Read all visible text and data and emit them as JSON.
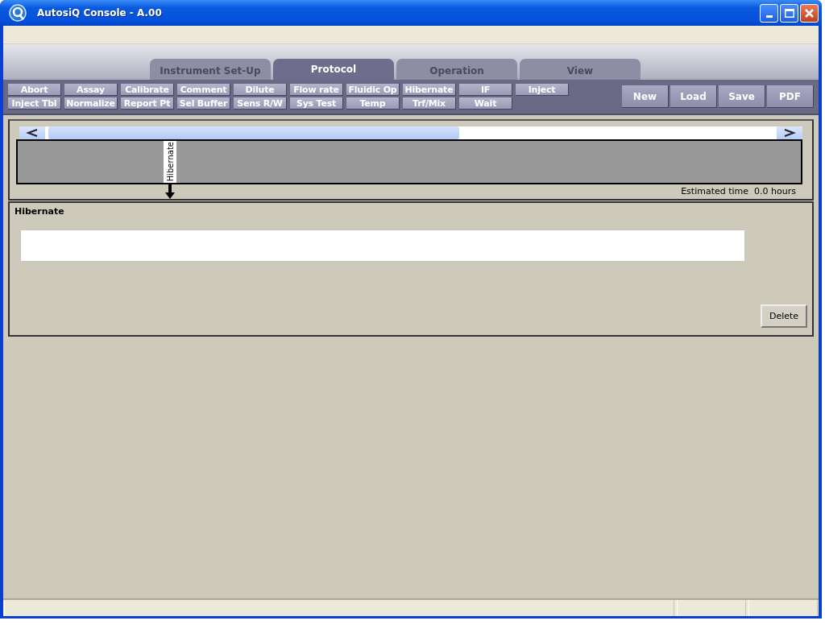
{
  "window": {
    "title": "AutosiQ Console - A.00"
  },
  "tabs": [
    {
      "label": "Instrument Set-Up",
      "selected": false
    },
    {
      "label": "Protocol",
      "selected": true
    },
    {
      "label": "Operation",
      "selected": false
    },
    {
      "label": "View",
      "selected": false
    }
  ],
  "commands": [
    [
      "Abort",
      "Assay",
      "Calibrate",
      "Comment",
      "Dilute",
      "Flow rate",
      "Fluidic Op",
      "Hibernate",
      "IF",
      "Inject"
    ],
    [
      "Inject Tbl",
      "Normalize",
      "Report Pt",
      "Sel Buffer",
      "Sens R/W",
      "Sys Test",
      "Temp",
      "Trf/Mix",
      "Wait"
    ]
  ],
  "file_buttons": [
    "New",
    "Load",
    "Save",
    "PDF"
  ],
  "timeline": {
    "steps": [
      {
        "label": "Hibernate"
      }
    ],
    "estimated_time": "Estimated time  0.0 hours"
  },
  "detail": {
    "title": "Hibernate",
    "delete_button": "Delete"
  }
}
